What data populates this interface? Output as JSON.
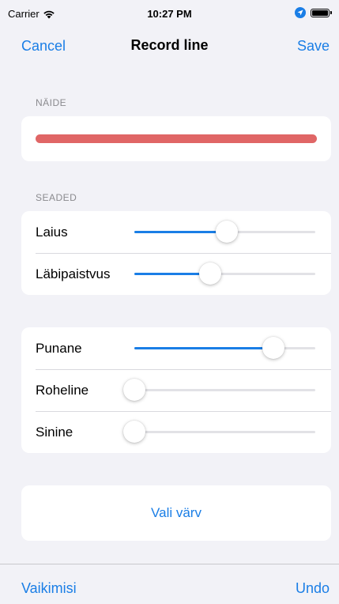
{
  "status_bar": {
    "carrier": "Carrier",
    "time": "10:27 PM",
    "icons": [
      "wifi-icon",
      "location-icon",
      "battery-icon"
    ]
  },
  "nav": {
    "cancel_label": "Cancel",
    "title": "Record line",
    "save_label": "Save"
  },
  "preview": {
    "header": "NÄIDE",
    "line_color": "#e06666"
  },
  "settings": {
    "header": "SEADED",
    "sliders": [
      {
        "label": "Laius",
        "value": 0.51
      },
      {
        "label": "Läbipaistvus",
        "value": 0.42
      }
    ]
  },
  "color": {
    "sliders": [
      {
        "label": "Punane",
        "value": 0.77
      },
      {
        "label": "Roheline",
        "value": 0.0
      },
      {
        "label": "Sinine",
        "value": 0.0
      }
    ],
    "choose_label": "Vali värv"
  },
  "toolbar": {
    "default_label": "Vaikimisi",
    "undo_label": "Undo"
  },
  "colors": {
    "accent": "#1a7ee6",
    "background": "#f2f2f7"
  }
}
